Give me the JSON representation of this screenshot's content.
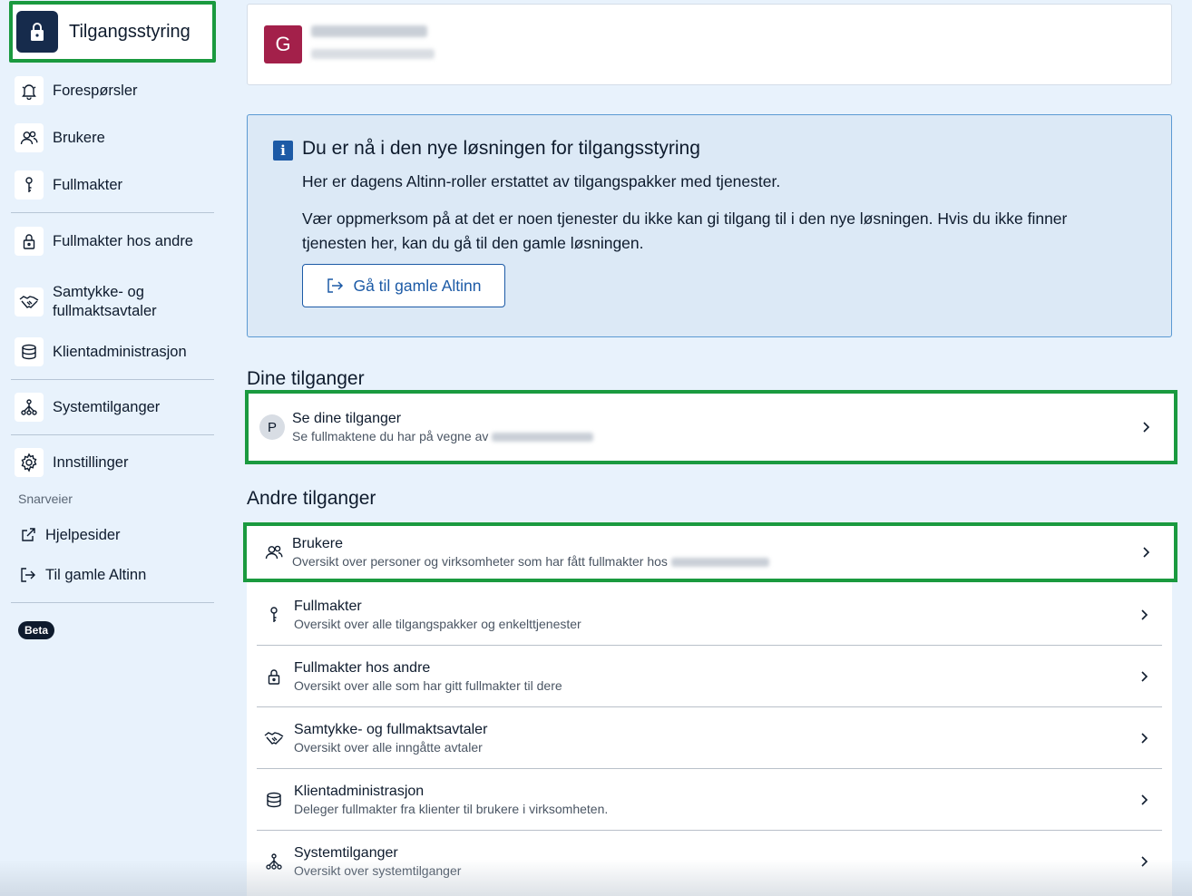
{
  "sidebar": {
    "brand_label": "Tilgangsstyring",
    "items": [
      {
        "label": "Forespørsler",
        "icon": "bell-icon"
      },
      {
        "label": "Brukere",
        "icon": "users-icon"
      },
      {
        "label": "Fullmakter",
        "icon": "key-icon"
      },
      {
        "label": "Fullmakter hos andre",
        "icon": "padlock-icon"
      },
      {
        "label": "Samtykke- og fullmaktsavtaler",
        "icon": "handshake-icon"
      },
      {
        "label": "Klientadministrasjon",
        "icon": "database-icon"
      },
      {
        "label": "Systemtilganger",
        "icon": "network-icon"
      },
      {
        "label": "Innstillinger",
        "icon": "gear-icon"
      }
    ],
    "shortcuts_label": "Snarveier",
    "shortcuts": [
      {
        "label": "Hjelpesider",
        "icon": "external-link-icon"
      },
      {
        "label": "Til gamle Altinn",
        "icon": "login-arrow-icon"
      }
    ],
    "beta_badge": "Beta"
  },
  "org": {
    "avatar_letter": "G"
  },
  "info": {
    "title": "Du er nå i den nye løsningen for tilgangsstyring",
    "p1": "Her er dagens Altinn-roller erstattet av tilgangspakker med tjenester.",
    "p2": "Vær oppmerksom på at det er noen tjenester du ikke kan gi tilgang til i den nye løsningen. Hvis du ikke finner tjenesten her, kan du gå til den gamle løsningen.",
    "button_label": "Gå til gamle Altinn"
  },
  "dine": {
    "heading": "Dine tilganger",
    "avatar_letter": "P",
    "title": "Se dine tilganger",
    "desc": "Se fullmaktene du har på vegne av"
  },
  "andre": {
    "heading": "Andre tilganger",
    "items": [
      {
        "title": "Brukere",
        "desc": "Oversikt over personer og virksomheter som har fått fullmakter hos",
        "icon": "users-icon"
      },
      {
        "title": "Fullmakter",
        "desc": "Oversikt over alle tilgangspakker og enkelttjenester",
        "icon": "key-icon"
      },
      {
        "title": "Fullmakter hos andre",
        "desc": "Oversikt over alle som har gitt fullmakter til dere",
        "icon": "padlock-icon"
      },
      {
        "title": "Samtykke- og fullmaktsavtaler",
        "desc": "Oversikt over alle inngåtte avtaler",
        "icon": "handshake-icon"
      },
      {
        "title": "Klientadministrasjon",
        "desc": "Deleger fullmakter fra klienter til brukere i virksomheten.",
        "icon": "database-icon"
      },
      {
        "title": "Systemtilganger",
        "desc": "Oversikt over systemtilganger",
        "icon": "network-icon"
      }
    ]
  },
  "colors": {
    "accent": "#1c5aa6",
    "highlight": "#1a9a3f",
    "avatar": "#a3204a",
    "background": "#e8f2fc"
  }
}
